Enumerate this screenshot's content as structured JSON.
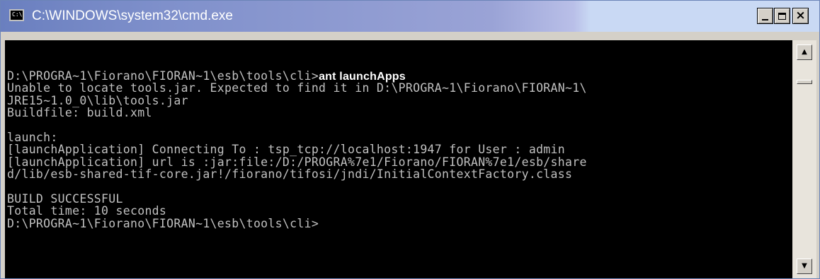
{
  "window": {
    "title": "C:\\WINDOWS\\system32\\cmd.exe",
    "app_icon": "console-icon",
    "app_icon_text": "C:\\"
  },
  "controls": {
    "minimize": "minimize-icon",
    "maximize": "maximize-icon",
    "close": "close-icon",
    "close_glyph": "×"
  },
  "console": {
    "colors": {
      "background": "#000000",
      "text": "#c0c0c0",
      "typed": "#ffffff"
    },
    "lines": [
      {
        "text": "D:\\PROGRA~1\\Fiorano\\FIORAN~1\\esb\\tools\\cli>",
        "typed": "ant launchApps"
      },
      {
        "text": "Unable to locate tools.jar. Expected to find it in D:\\PROGRA~1\\Fiorano\\FIORAN~1\\"
      },
      {
        "text": "JRE15~1.0_0\\lib\\tools.jar"
      },
      {
        "text": "Buildfile: build.xml"
      },
      {
        "text": ""
      },
      {
        "text": "launch:"
      },
      {
        "text": "[launchApplication] Connecting To : tsp_tcp://localhost:1947 for User : admin"
      },
      {
        "text": "[launchApplication] url is :jar:file:/D:/PROGRA%7e1/Fiorano/FIORAN%7e1/esb/share"
      },
      {
        "text": "d/lib/esb-shared-tif-core.jar!/fiorano/tifosi/jndi/InitialContextFactory.class"
      },
      {
        "text": ""
      },
      {
        "text": "BUILD SUCCESSFUL"
      },
      {
        "text": "Total time: 10 seconds"
      },
      {
        "text": "D:\\PROGRA~1\\Fiorano\\FIORAN~1\\esb\\tools\\cli>"
      }
    ]
  },
  "scrollbar": {
    "up_glyph": "▲",
    "down_glyph": "▼"
  }
}
